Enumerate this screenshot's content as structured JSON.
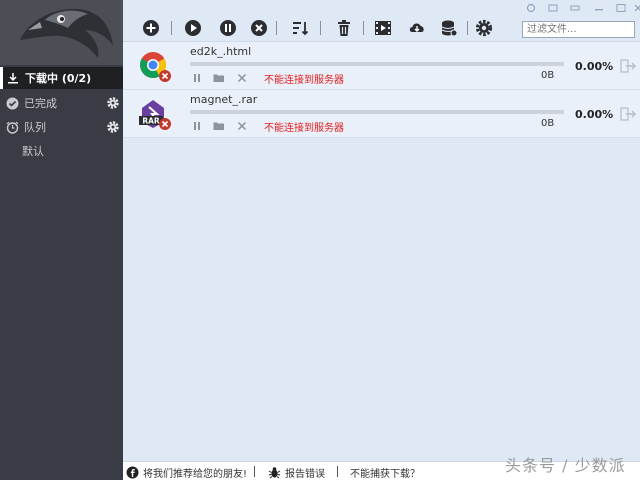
{
  "sidebar": {
    "downloading_label": "下载中 (0/2)",
    "completed_label": "已完成",
    "queue_label": "队列",
    "default_label": "默认"
  },
  "toolbar": {
    "filter_placeholder": "过滤文件..."
  },
  "tasks": [
    {
      "name": "ed2k_.html",
      "error": "不能连接到服务器",
      "size": "0B",
      "percent": "0.00%",
      "progress": 0,
      "icon": "chrome-html-icon"
    },
    {
      "name": "magnet_.rar",
      "error": "不能连接到服务器",
      "size": "0B",
      "percent": "0.00%",
      "progress": 0,
      "icon": "rar-archive-icon"
    }
  ],
  "statusbar": {
    "recommend": "将我们推荐给您的朋友!",
    "report": "报告错误",
    "capture": "不能捕获下载？"
  },
  "watermark": "头条号 / 少数派",
  "colors": {
    "error": "#e02020",
    "sidebar": "#393c44",
    "toolbar": "#dfe9f6"
  }
}
